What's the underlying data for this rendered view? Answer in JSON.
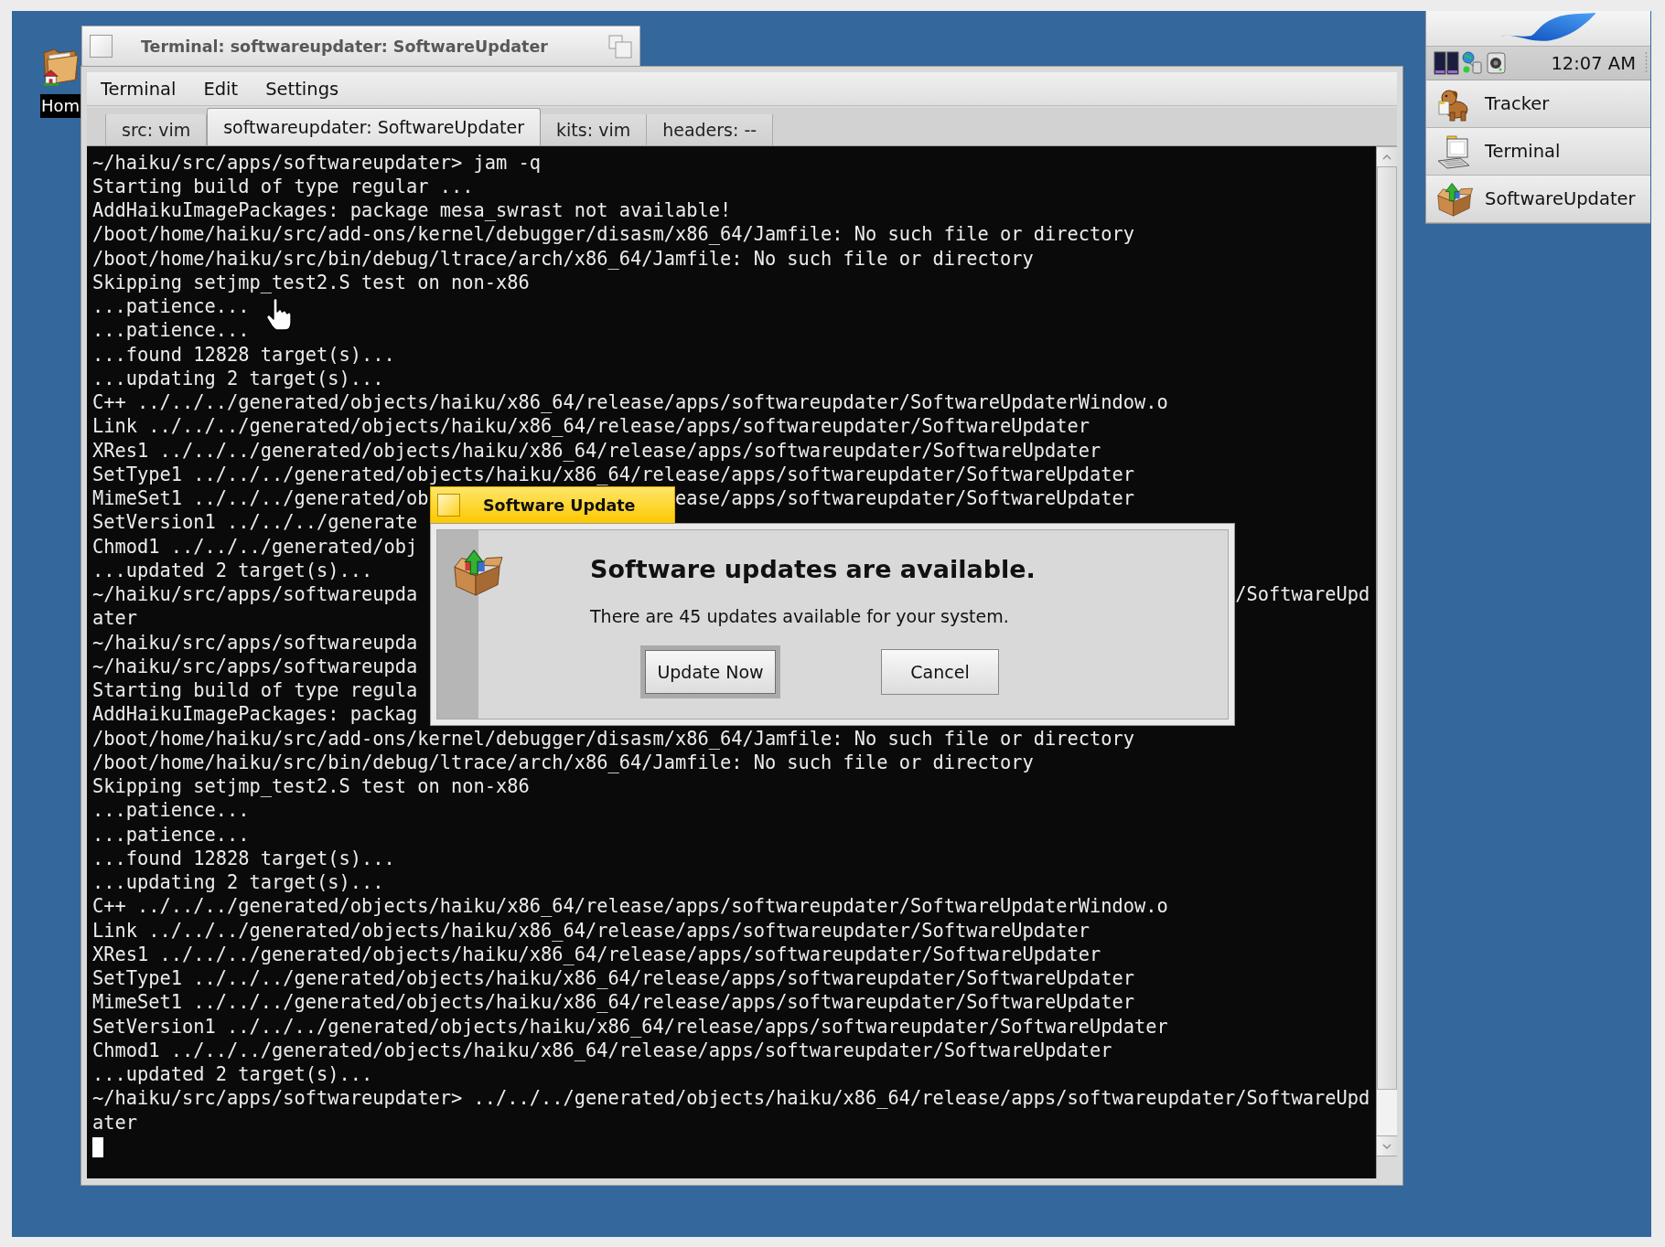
{
  "desktop": {
    "icons": [
      {
        "label": "Hom"
      }
    ]
  },
  "terminal_window": {
    "title": "Terminal: softwareupdater: SoftwareUpdater",
    "menu": [
      "Terminal",
      "Edit",
      "Settings"
    ],
    "tabs": [
      {
        "label": "src: vim",
        "selected": false
      },
      {
        "label": "softwareupdater: SoftwareUpdater",
        "selected": true
      },
      {
        "label": "kits: vim",
        "selected": false
      },
      {
        "label": "headers: --",
        "selected": false
      }
    ],
    "lines": [
      {
        "text": "~/haiku/src/apps/softwareupdater> jam -q"
      },
      {
        "text": "Starting build of type regular ..."
      },
      {
        "text": "AddHaikuImagePackages: package mesa_swrast not available!"
      },
      {
        "text": "/boot/home/haiku/src/add-ons/kernel/debugger/disasm/x86_64/Jamfile: No such file or directory"
      },
      {
        "text": "/boot/home/haiku/src/bin/debug/ltrace/arch/x86_64/Jamfile: No such file or directory"
      },
      {
        "text": "Skipping setjmp_test2.S test on non-x86"
      },
      {
        "text": "...patience..."
      },
      {
        "text": "...patience..."
      },
      {
        "text": "...found 12828 target(s)..."
      },
      {
        "text": "...updating 2 target(s)..."
      },
      {
        "text": "C++ ../../../generated/objects/haiku/x86_64/release/apps/softwareupdater/SoftwareUpdaterWindow.o"
      },
      {
        "text": "Link ../../../generated/objects/haiku/x86_64/release/apps/softwareupdater/SoftwareUpdater"
      },
      {
        "text": "XRes1 ../../../generated/objects/haiku/x86_64/release/apps/softwareupdater/SoftwareUpdater"
      },
      {
        "text": "SetType1 ../../../generated/objects/haiku/x86_64/release/apps/softwareupdater/SoftwareUpdater"
      },
      {
        "text": "MimeSet1 ../../../generated/ob",
        "tail": "ease/apps/softwareupdater/SoftwareUpdater"
      },
      {
        "text": "SetVersion1 ../../../generate"
      },
      {
        "text": "Chmod1 ../../../generated/obj"
      },
      {
        "text": "...updated 2 target(s)..."
      },
      {
        "text": "~/haiku/src/apps/softwareupda",
        "tail": "/SoftwareUpd"
      },
      {
        "text": "ater"
      },
      {
        "text": "~/haiku/src/apps/softwareupda"
      },
      {
        "text": "~/haiku/src/apps/softwareupda"
      },
      {
        "text": "Starting build of type regula"
      },
      {
        "text": "AddHaikuImagePackages: packag"
      },
      {
        "text": "/boot/home/haiku/src/add-ons/kernel/debugger/disasm/x86_64/Jamfile: No such file or directory"
      },
      {
        "text": "/boot/home/haiku/src/bin/debug/ltrace/arch/x86_64/Jamfile: No such file or directory"
      },
      {
        "text": "Skipping setjmp_test2.S test on non-x86"
      },
      {
        "text": "...patience..."
      },
      {
        "text": "...patience..."
      },
      {
        "text": "...found 12828 target(s)..."
      },
      {
        "text": "...updating 2 target(s)..."
      },
      {
        "text": "C++ ../../../generated/objects/haiku/x86_64/release/apps/softwareupdater/SoftwareUpdaterWindow.o"
      },
      {
        "text": "Link ../../../generated/objects/haiku/x86_64/release/apps/softwareupdater/SoftwareUpdater"
      },
      {
        "text": "XRes1 ../../../generated/objects/haiku/x86_64/release/apps/softwareupdater/SoftwareUpdater"
      },
      {
        "text": "SetType1 ../../../generated/objects/haiku/x86_64/release/apps/softwareupdater/SoftwareUpdater"
      },
      {
        "text": "MimeSet1 ../../../generated/objects/haiku/x86_64/release/apps/softwareupdater/SoftwareUpdater"
      },
      {
        "text": "SetVersion1 ../../../generated/objects/haiku/x86_64/release/apps/softwareupdater/SoftwareUpdater"
      },
      {
        "text": "Chmod1 ../../../generated/objects/haiku/x86_64/release/apps/softwareupdater/SoftwareUpdater"
      },
      {
        "text": "...updated 2 target(s)..."
      },
      {
        "text": "~/haiku/src/apps/softwareupdater> ../../../generated/objects/haiku/x86_64/release/apps/softwareupdater/SoftwareUpd"
      },
      {
        "text": "ater"
      }
    ]
  },
  "dialog": {
    "title": "Software Update",
    "heading": "Software updates are available.",
    "message": "There are 45 updates available for your system.",
    "buttons": [
      {
        "label": "Update Now",
        "default": true
      },
      {
        "label": "Cancel",
        "default": false
      }
    ]
  },
  "deskbar": {
    "clock": "12:07 AM",
    "apps": [
      {
        "label": "Tracker"
      },
      {
        "label": "Terminal"
      },
      {
        "label": "SoftwareUpdater"
      }
    ]
  }
}
